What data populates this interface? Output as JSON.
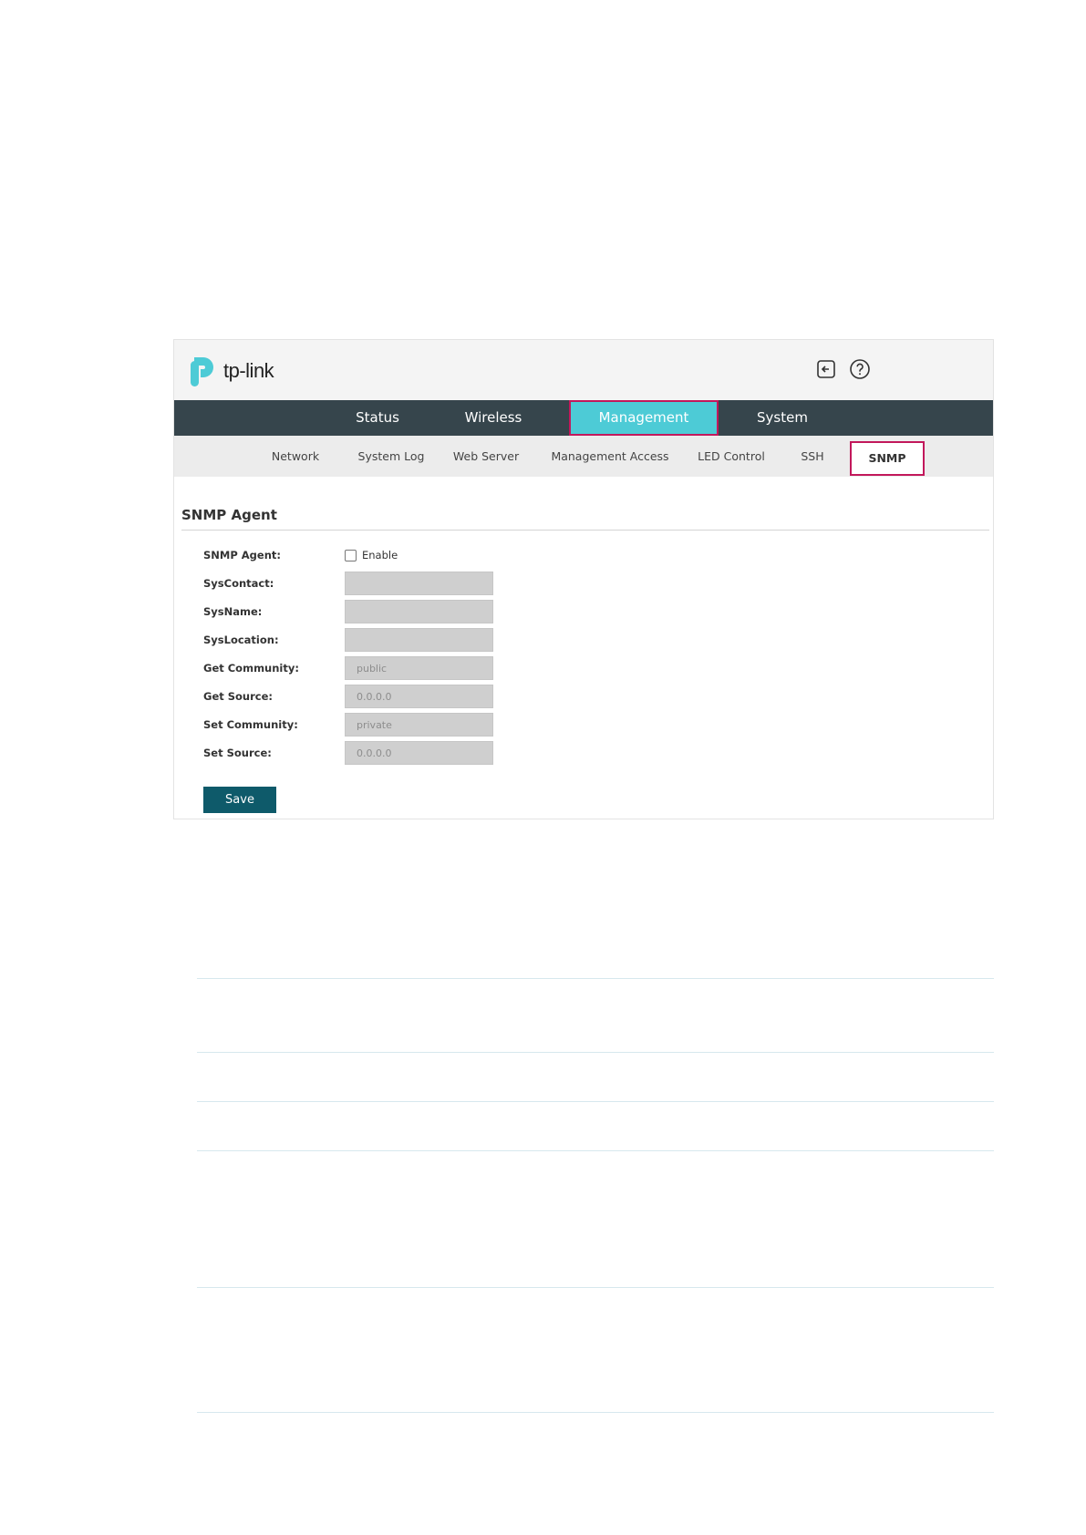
{
  "brand": {
    "name": "tp-link",
    "color": "#4dcbd6"
  },
  "header": {
    "icons": [
      "logout-icon",
      "help-icon"
    ]
  },
  "nav": {
    "items": [
      {
        "label": "Status"
      },
      {
        "label": "Wireless"
      },
      {
        "label": "Management",
        "active": true
      },
      {
        "label": "System"
      }
    ]
  },
  "subnav": {
    "items": [
      {
        "label": "Network"
      },
      {
        "label": "System Log"
      },
      {
        "label": "Web Server"
      },
      {
        "label": "Management Access"
      },
      {
        "label": "LED Control"
      },
      {
        "label": "SSH"
      },
      {
        "label": "SNMP",
        "active": true
      }
    ]
  },
  "section": {
    "title": "SNMP Agent"
  },
  "form": {
    "snmp_agent": {
      "label": "SNMP Agent:",
      "checkbox_label": "Enable",
      "checked": false
    },
    "fields": [
      {
        "label": "SysContact:",
        "value": ""
      },
      {
        "label": "SysName:",
        "value": ""
      },
      {
        "label": "SysLocation:",
        "value": ""
      },
      {
        "label": "Get Community:",
        "value": "public"
      },
      {
        "label": "Get Source:",
        "value": "0.0.0.0"
      },
      {
        "label": "Set Community:",
        "value": "private"
      },
      {
        "label": "Set Source:",
        "value": "0.0.0.0"
      }
    ],
    "save_label": "Save"
  },
  "colors": {
    "nav_bg": "#36454c",
    "active_tab": "#4dcbd6",
    "highlight_border": "#c2185b",
    "save_button": "#0e5a6a"
  }
}
